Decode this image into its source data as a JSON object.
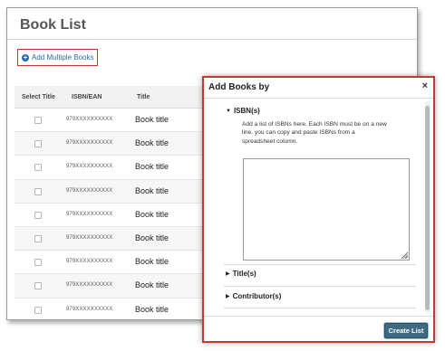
{
  "book_list": {
    "title": "Book List",
    "add_multiple_label": "Add Multiple Books",
    "columns": {
      "select": "Select Title",
      "isbn": "ISBN/EAN",
      "title": "Title"
    },
    "rows": [
      {
        "isbn": "979XXXXXXXXXX",
        "title": "Book title"
      },
      {
        "isbn": "979XXXXXXXXXX",
        "title": "Book title"
      },
      {
        "isbn": "979XXXXXXXXXX",
        "title": "Book title"
      },
      {
        "isbn": "979XXXXXXXXXX",
        "title": "Book title"
      },
      {
        "isbn": "979XXXXXXXXXX",
        "title": "Book title"
      },
      {
        "isbn": "979XXXXXXXXXX",
        "title": "Book title"
      },
      {
        "isbn": "979XXXXXXXXXX",
        "title": "Book title"
      },
      {
        "isbn": "979XXXXXXXXXX",
        "title": "Book title"
      },
      {
        "isbn": "979XXXXXXXXXX",
        "title": "Book title"
      }
    ]
  },
  "modal": {
    "title": "Add Books by",
    "close_glyph": "×",
    "sections": {
      "isbn": {
        "label": "ISBN(s)",
        "expanded": true,
        "help": "Add a list of ISBNs here. Each ISBN must be on a new line. you can copy and paste ISBNs from a spreadsheet column.",
        "value": ""
      },
      "title": {
        "label": "Title(s)",
        "expanded": false
      },
      "contributor": {
        "label": "Contributor(s)",
        "expanded": false
      }
    },
    "create_button": "Create List"
  },
  "icons": {
    "add": "plus-circle-icon",
    "close": "close-icon",
    "expanded": "triangle-down-icon",
    "collapsed": "triangle-right-icon"
  },
  "colors": {
    "highlight": "#c23b33",
    "link": "#2a6aa8",
    "primary_button": "#3f6b82"
  }
}
